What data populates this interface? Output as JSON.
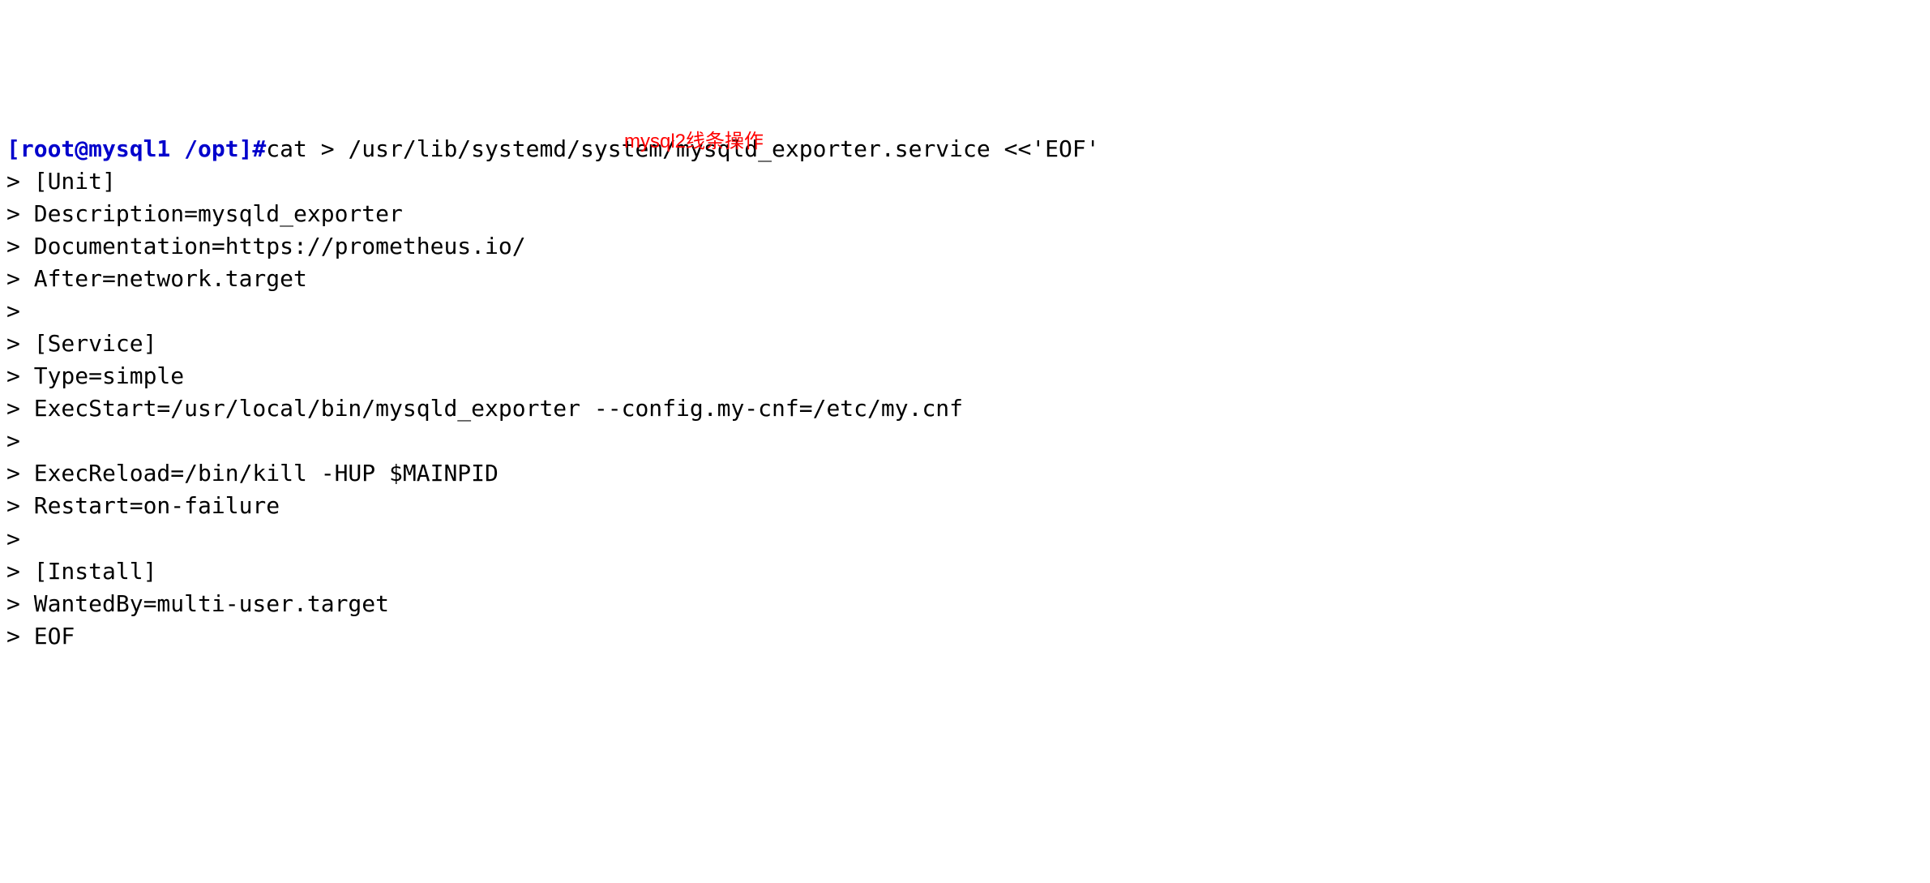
{
  "terminal": {
    "prompt": "[root@mysql1 /opt]#",
    "command": "cat > /usr/lib/systemd/system/mysqld_exporter.service <<'EOF'",
    "heredoc_lines": [
      "> [Unit]",
      "> Description=mysqld_exporter",
      "> Documentation=https://prometheus.io/",
      "> After=network.target",
      "> ",
      "> [Service]",
      "> Type=simple",
      "> ExecStart=/usr/local/bin/mysqld_exporter --config.my-cnf=/etc/my.cnf",
      "> ",
      "> ExecReload=/bin/kill -HUP $MAINPID",
      "> Restart=on-failure",
      "> ",
      "> [Install]",
      "> WantedBy=multi-user.target",
      "> EOF"
    ]
  },
  "annotation": {
    "text": "mysql2线条操作"
  }
}
